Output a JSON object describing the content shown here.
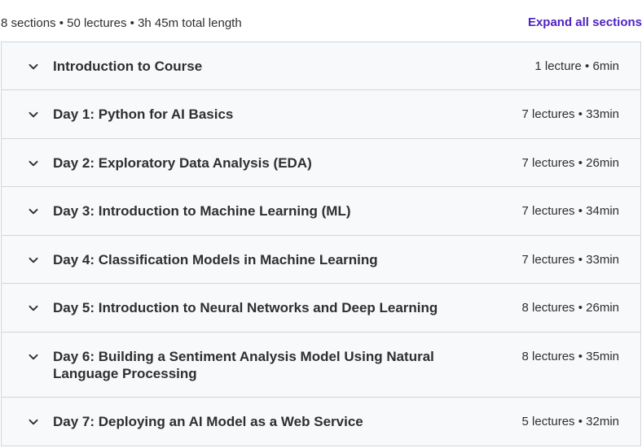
{
  "curriculum": {
    "summary": "8 sections • 50 lectures • 3h 45m total length",
    "expand_label": "Expand all sections",
    "accent_color": "#5022c3",
    "sections": [
      {
        "title": "Introduction to Course",
        "meta": "1 lecture • 6min"
      },
      {
        "title": "Day 1: Python for AI Basics",
        "meta": "7 lectures • 33min"
      },
      {
        "title": "Day 2: Exploratory Data Analysis (EDA)",
        "meta": "7 lectures • 26min"
      },
      {
        "title": "Day 3: Introduction to Machine Learning (ML)",
        "meta": "7 lectures • 34min"
      },
      {
        "title": "Day 4: Classification Models in Machine Learning",
        "meta": "7 lectures • 33min"
      },
      {
        "title": "Day 5: Introduction to Neural Networks and Deep Learning",
        "meta": "8 lectures • 26min"
      },
      {
        "title": "Day 6: Building a Sentiment Analysis Model Using Natural Language Processing",
        "meta": "8 lectures • 35min"
      },
      {
        "title": "Day 7: Deploying an AI Model as a Web Service",
        "meta": "5 lectures • 32min"
      }
    ],
    "chevron_icon": "chevron-down-icon"
  }
}
